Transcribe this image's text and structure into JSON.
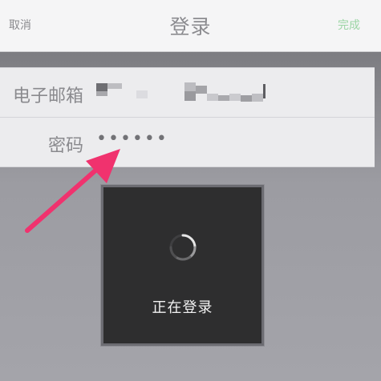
{
  "navbar": {
    "cancel_label": "取消",
    "title": "登录",
    "done_label": "完成"
  },
  "form": {
    "email_label": "电子邮箱",
    "password_label": "密码",
    "password_mask": "••••••"
  },
  "loading": {
    "label": "正在登录"
  },
  "colors": {
    "done": "#9bd5a4",
    "arrow": "#f0326e",
    "hud": "#2e2e2f"
  }
}
